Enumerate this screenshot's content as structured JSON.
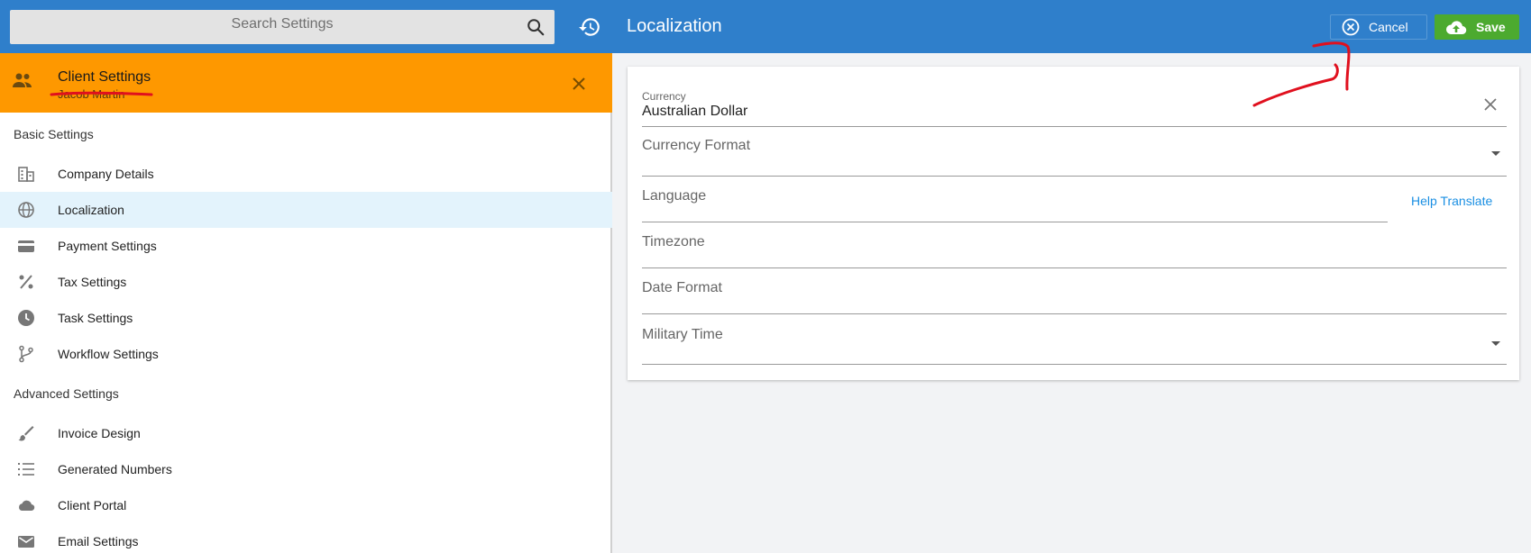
{
  "search": {
    "placeholder": "Search Settings"
  },
  "client": {
    "title": "Client Settings",
    "subtitle": "Jacob Martin"
  },
  "sidebar": {
    "basic_heading": "Basic Settings",
    "basic": [
      {
        "label": "Company Details",
        "icon": "building-icon"
      },
      {
        "label": "Localization",
        "icon": "globe-icon"
      },
      {
        "label": "Payment Settings",
        "icon": "credit-card-icon"
      },
      {
        "label": "Tax Settings",
        "icon": "percent-icon"
      },
      {
        "label": "Task Settings",
        "icon": "clock-icon"
      },
      {
        "label": "Workflow Settings",
        "icon": "branch-icon"
      }
    ],
    "advanced_heading": "Advanced Settings",
    "advanced": [
      {
        "label": "Invoice Design",
        "icon": "brush-icon"
      },
      {
        "label": "Generated Numbers",
        "icon": "numbered-list-icon"
      },
      {
        "label": "Client Portal",
        "icon": "cloud-icon"
      },
      {
        "label": "Email Settings",
        "icon": "mail-icon"
      }
    ],
    "active_item": "Localization"
  },
  "header": {
    "title": "Localization",
    "cancel_label": "Cancel",
    "save_label": "Save"
  },
  "form": {
    "currency": {
      "label": "Currency",
      "value": "Australian Dollar"
    },
    "currency_format": {
      "label": "Currency Format",
      "value": ""
    },
    "language": {
      "label": "Language",
      "value": "",
      "help_link": "Help Translate"
    },
    "timezone": {
      "label": "Timezone",
      "value": ""
    },
    "date_format": {
      "label": "Date Format",
      "value": ""
    },
    "military_time": {
      "label": "Military Time",
      "value": ""
    }
  },
  "colors": {
    "header_blue": "#2f7fcb",
    "client_orange": "#fe9800",
    "active_row": "#e3f3fc",
    "save_green": "#4caa2f",
    "link_blue": "#1a8fe3",
    "annotation_red": "#e0101e"
  }
}
